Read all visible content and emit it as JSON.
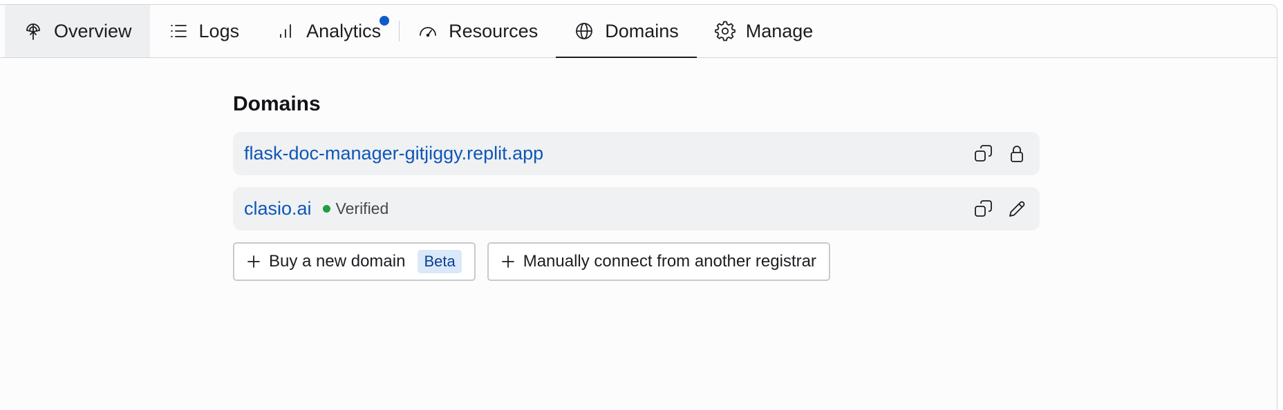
{
  "tabs": [
    {
      "id": "overview",
      "label": "Overview",
      "icon": "antenna-icon"
    },
    {
      "id": "logs",
      "label": "Logs",
      "icon": "list-icon"
    },
    {
      "id": "analytics",
      "label": "Analytics",
      "icon": "bar-chart-icon"
    },
    {
      "id": "resources",
      "label": "Resources",
      "icon": "gauge-icon"
    },
    {
      "id": "domains",
      "label": "Domains",
      "icon": "globe-icon"
    },
    {
      "id": "manage",
      "label": "Manage",
      "icon": "gear-icon"
    }
  ],
  "active_tab": "Domains",
  "domains_section": {
    "title": "Domains",
    "domains": [
      {
        "name": "flask-doc-manager-gitjiggy.replit.app",
        "status": "",
        "actions": [
          "copy-icon",
          "lock-icon"
        ]
      },
      {
        "name": "clasio.ai",
        "status": "Verified",
        "actions": [
          "copy-icon",
          "pencil-icon"
        ]
      }
    ],
    "buy_button": {
      "label": "Buy a new domain",
      "badge": "Beta"
    },
    "connect_button": {
      "label": "Manually connect from another registrar"
    }
  },
  "colors": {
    "link": "#0e56b8",
    "notification_dot": "#0d5cc7",
    "verified_dot": "#1f9e3f",
    "beta_badge_bg": "#dbe8fa"
  }
}
